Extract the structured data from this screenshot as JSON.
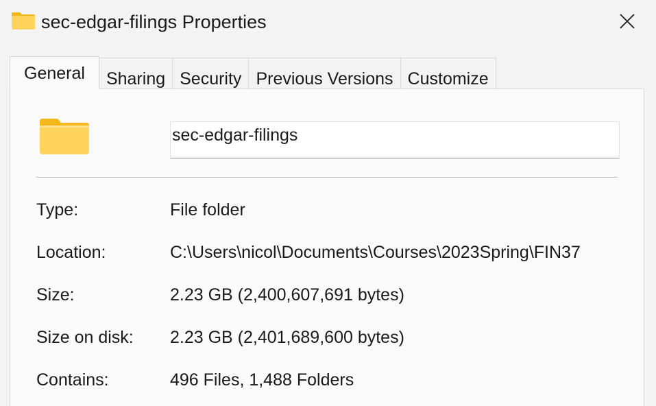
{
  "window": {
    "title": "sec-edgar-filings Properties",
    "icon": "folder-icon",
    "close_icon": "close-icon"
  },
  "tabs": [
    {
      "label": "General",
      "active": true
    },
    {
      "label": "Sharing",
      "active": false
    },
    {
      "label": "Security",
      "active": false
    },
    {
      "label": "Previous Versions",
      "active": false
    },
    {
      "label": "Customize",
      "active": false
    }
  ],
  "general": {
    "folder_name": "sec-edgar-filings",
    "rows": [
      {
        "label": "Type:",
        "value": "File folder"
      },
      {
        "label": "Location:",
        "value": "C:\\Users\\nicol\\Documents\\Courses\\2023Spring\\FIN37"
      },
      {
        "label": "Size:",
        "value": "2.23 GB (2,400,607,691 bytes)"
      },
      {
        "label": "Size on disk:",
        "value": "2.23 GB (2,401,689,600 bytes)"
      },
      {
        "label": "Contains:",
        "value": "496 Files, 1,488 Folders"
      }
    ]
  },
  "colors": {
    "folder_body": "#ffd35c",
    "folder_tab": "#f5b81c",
    "background": "#f3f3f3",
    "panel": "#fafafa"
  }
}
